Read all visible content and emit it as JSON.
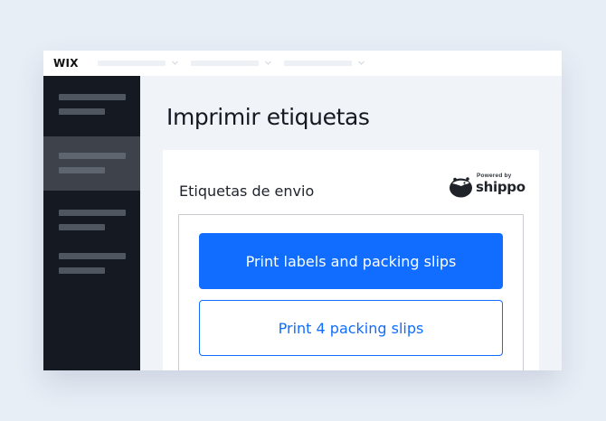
{
  "app": {
    "logo": "WIX"
  },
  "topbar": {
    "menus": [
      "",
      "",
      ""
    ]
  },
  "main": {
    "page_title": "Imprimir etiquetas"
  },
  "card": {
    "title": "Etiquetas de envio",
    "provider": {
      "powered_by": "Powered by",
      "name": "shippo"
    },
    "actions": {
      "primary_label": "Print labels and packing slips",
      "secondary_label": "Print 4 packing slips"
    }
  },
  "colors": {
    "accent": "#116dff",
    "sidebar_bg": "#151a22",
    "sidebar_active": "#3e434b",
    "page_bg": "#e8eef6",
    "main_bg": "#f0f4f8"
  }
}
